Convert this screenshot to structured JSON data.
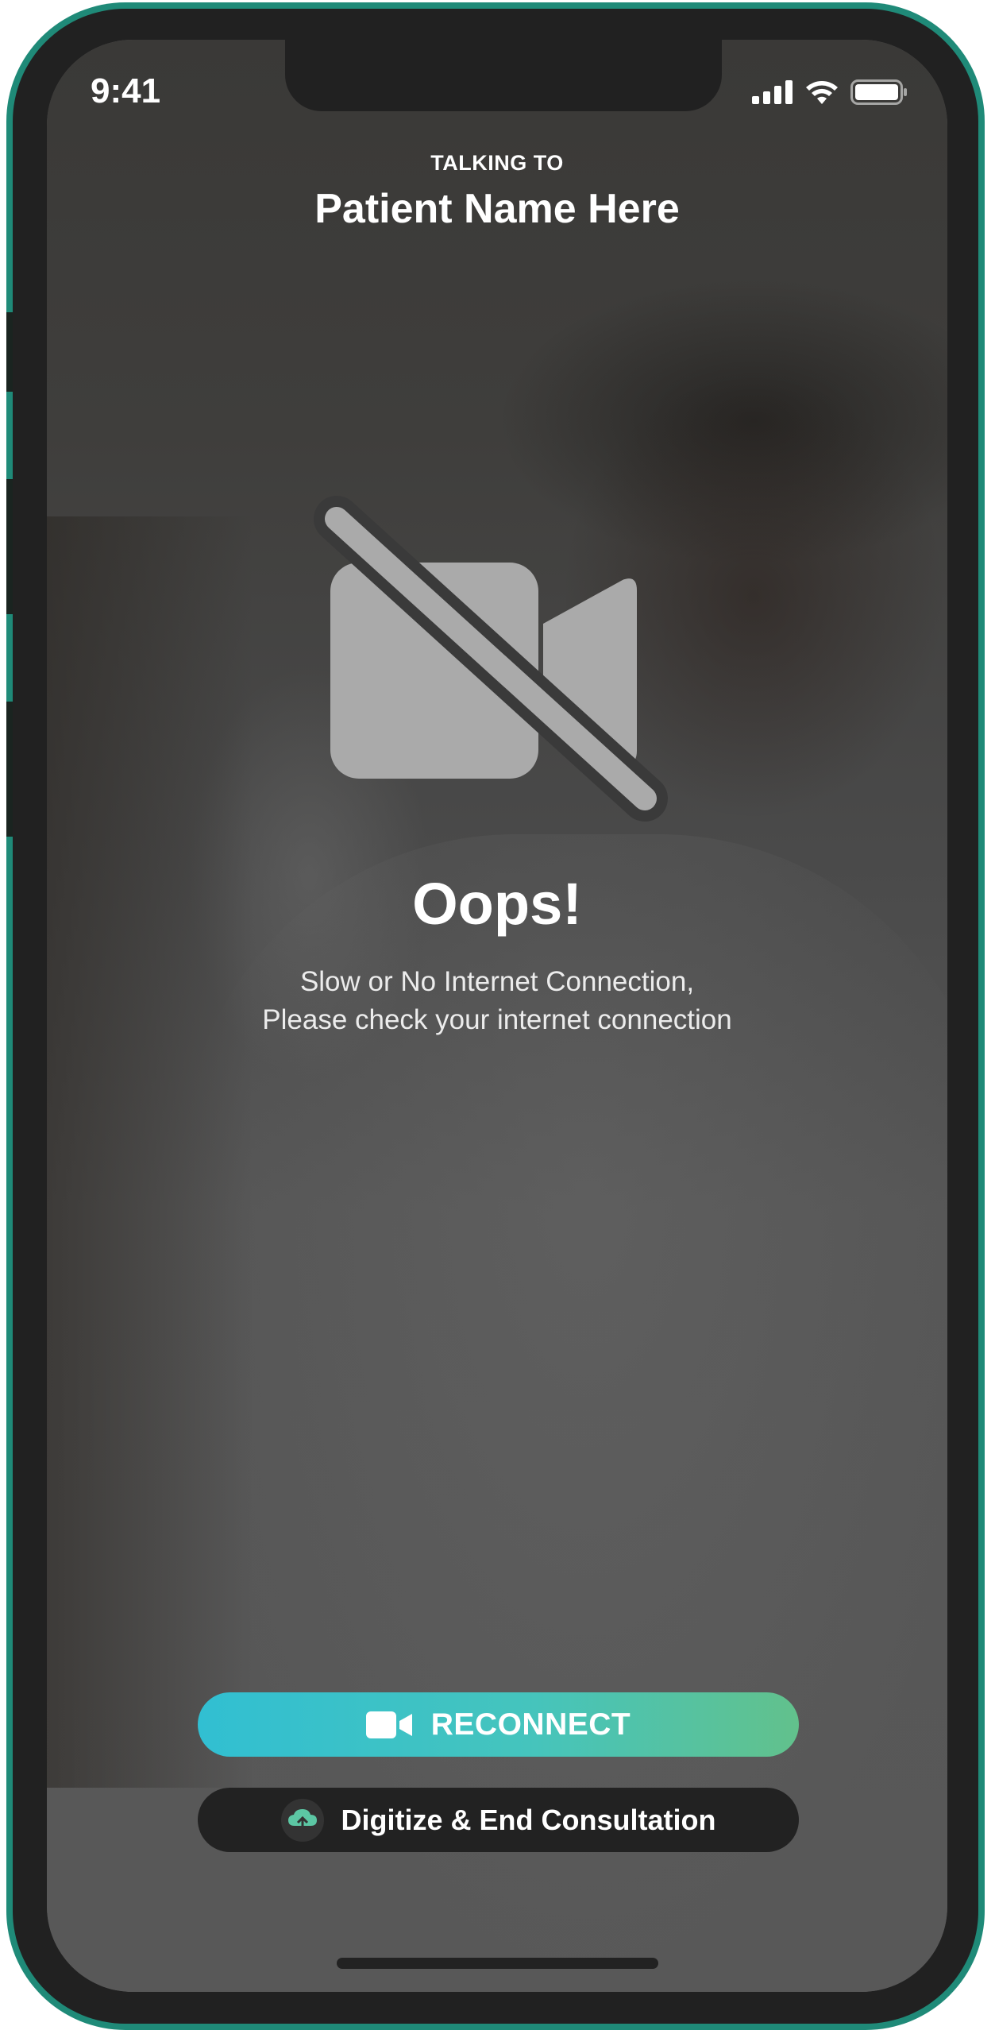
{
  "status_bar": {
    "time": "9:41",
    "icons": [
      "cellular-signal-icon",
      "wifi-icon",
      "battery-icon"
    ]
  },
  "header": {
    "label": "TALKING TO",
    "patient_name": "Patient Name Here"
  },
  "error": {
    "icon": "video-off-icon",
    "title": "Oops!",
    "line1": "Slow or No Internet Connection,",
    "line2": "Please check your internet connection"
  },
  "actions": {
    "reconnect_label": "RECONNECT",
    "reconnect_icon": "video-camera-icon",
    "digitize_label": "Digitize & End Consultation",
    "digitize_icon": "cloud-upload-icon"
  },
  "colors": {
    "device_frame": "#1f8a78",
    "reconnect_gradient_start": "#31bfd2",
    "reconnect_gradient_end": "#62c18c",
    "digitize_button": "#222222",
    "icon_gray": "#aaaaaa"
  }
}
